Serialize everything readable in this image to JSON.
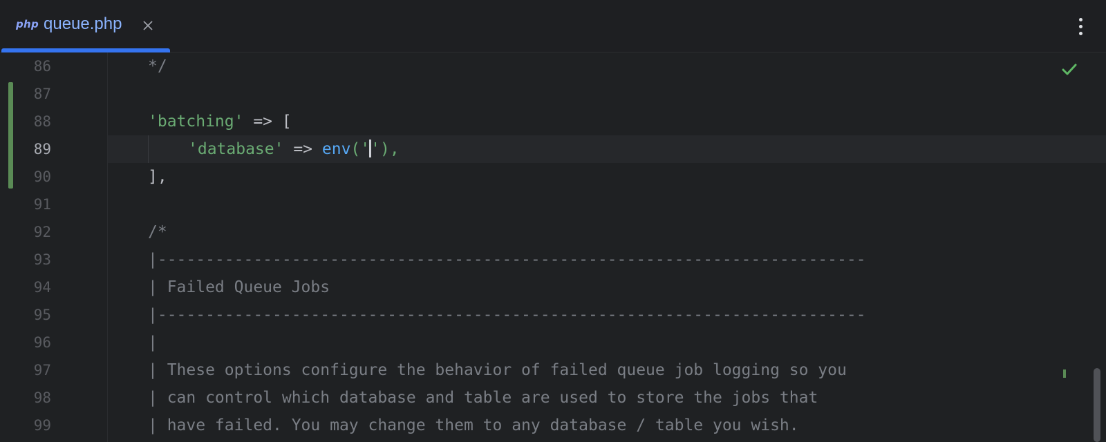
{
  "tab": {
    "icon_label": "php",
    "file_name": "queue.php"
  },
  "lines": {
    "l86": {
      "number": "86",
      "text": "*/"
    },
    "l87": {
      "number": "87",
      "text": ""
    },
    "l88": {
      "number": "88",
      "key": "'batching'",
      "arrow": " => ",
      "rest": "["
    },
    "l89": {
      "number": "89",
      "key": "'database'",
      "arrow": " => ",
      "fn": "env",
      "open": "('",
      "close": "'),"
    },
    "l90": {
      "number": "90",
      "text": "],"
    },
    "l91": {
      "number": "91",
      "text": ""
    },
    "l92": {
      "number": "92",
      "text": "/*"
    },
    "l93": {
      "number": "93",
      "text": "|--------------------------------------------------------------------------"
    },
    "l94": {
      "number": "94",
      "text": "| Failed Queue Jobs"
    },
    "l95": {
      "number": "95",
      "text": "|--------------------------------------------------------------------------"
    },
    "l96": {
      "number": "96",
      "text": "|"
    },
    "l97": {
      "number": "97",
      "text": "| These options configure the behavior of failed queue job logging so you"
    },
    "l98": {
      "number": "98",
      "text": "| can control which database and table are used to store the jobs that"
    },
    "l99": {
      "number": "99",
      "text": "| have failed. You may change them to any database / table you wish."
    }
  },
  "current_line": "89",
  "colors": {
    "background": "#1f2123",
    "accent": "#3574f0",
    "string": "#6aab73",
    "function": "#56a8f5",
    "comment": "#7a7e85",
    "change_marker": "#5a8b55"
  },
  "icons": {
    "language": "php-icon",
    "close": "close-icon",
    "more": "more-vertical-icon",
    "status": "checkmark-icon"
  }
}
